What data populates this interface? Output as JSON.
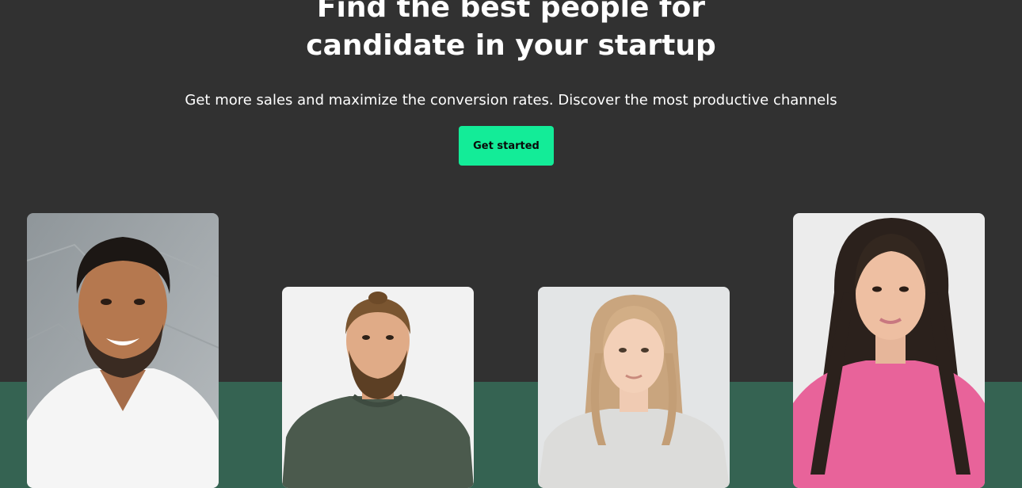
{
  "hero": {
    "title_line1": "Find the best people for",
    "title_line2": "candidate in your startup",
    "subtitle": "Get more sales and maximize the conversion rates. Discover the most productive channels",
    "cta_label": "Get started"
  },
  "colors": {
    "background": "#313131",
    "band": "#356352",
    "accent": "#13ec98"
  },
  "people": [
    {
      "id": "person-1",
      "description": "man-dark-hair-white-tee"
    },
    {
      "id": "person-2",
      "description": "man-beard-green-sweater"
    },
    {
      "id": "person-3",
      "description": "woman-blonde-grey-sweater"
    },
    {
      "id": "person-4",
      "description": "woman-dark-hair-pink-sweater"
    }
  ]
}
